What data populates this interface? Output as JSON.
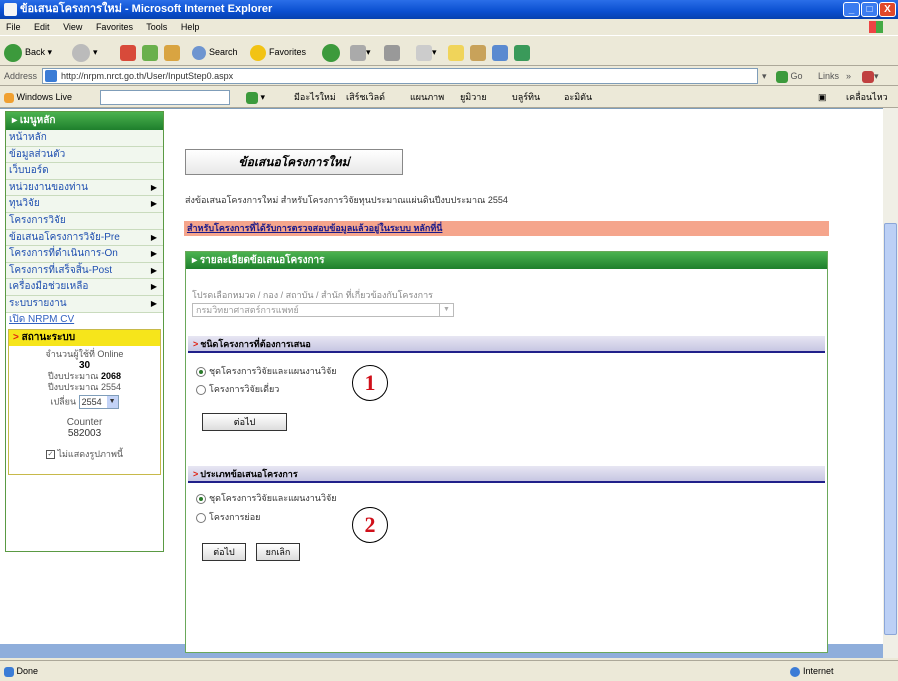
{
  "window": {
    "title": "ข้อเสนอโครงการใหม่ - Microsoft Internet Explorer",
    "min": "_",
    "max": "□",
    "close": "X"
  },
  "menu": [
    "File",
    "Edit",
    "View",
    "Favorites",
    "Tools",
    "Help"
  ],
  "toolbar": {
    "back": "Back",
    "search": "Search",
    "favorites": "Favorites"
  },
  "address": {
    "label": "Address",
    "url": "http://nrpm.nrct.go.th/User/InputStep0.aspx",
    "go": "Go",
    "links": "Links"
  },
  "links_bar": {
    "windows_live": "Windows Live",
    "items": [
      "มีอะไรใหม่",
      "เสิร์ชเวิลด์",
      "แผนภาพ",
      "ยูมิวาย",
      "บลูร์ทิน",
      "อะมิตัน"
    ],
    "right": "เคลื่อนไหว"
  },
  "sidebar": {
    "header": "เมนูหลัก",
    "items": [
      {
        "label": "หน้าหลัก",
        "submenu": false
      },
      {
        "label": "ข้อมูลส่วนตัว",
        "submenu": false
      },
      {
        "label": "เว็บบอร์ด",
        "submenu": false
      },
      {
        "label": "หน่วยงานของท่าน",
        "submenu": true
      },
      {
        "label": "ทุนวิจัย",
        "submenu": true
      },
      {
        "label": "โครงการวิจัย",
        "submenu": false
      },
      {
        "label": "ข้อเสนอโครงการวิจัย-Pre",
        "submenu": true
      },
      {
        "label": "โครงการที่ดำเนินการ-On",
        "submenu": true
      },
      {
        "label": "โครงการที่เสร็จสิ้น-Post",
        "submenu": true
      },
      {
        "label": "เครื่องมือช่วยเหลือ",
        "submenu": true
      },
      {
        "label": "ระบบรายงาน",
        "submenu": true
      }
    ],
    "extra_link": "เปิด NRPM CV",
    "status": {
      "header": "สถานะระบบ",
      "online_label": "จำนวนผู้ใช้ที่ Online",
      "online_count": "30",
      "fiscal_label": "ปีงบประมาณ",
      "fiscal_year_value": "2068",
      "budget_label": "ปีงบประมาณ 2554",
      "year_label": "เปลี่ยน",
      "year_value": "2554",
      "counter_label": "Counter",
      "counter_value": "582003",
      "remember_label": "ไม่แสดงรูปภาพนี้"
    }
  },
  "main": {
    "page_title": "ข้อเสนอโครงการใหม่",
    "description": "ส่งข้อเสนอโครงการใหม่ สำหรับโครงการวิจัยทุนประมาณแผ่นดินปีงบประมาณ 2554",
    "notice": "สำหรับโครงการที่ได้รับการตรวจสอบข้อมูลแล้วอยู่ในระบบ หลักที่นี่",
    "panel_title": "รายละเอียดข้อเสนอโครงการ",
    "instruction": "โปรดเลือกหมวด / กอง / สถาบัน / สำนัก ที่เกี่ยวข้องกับโครงการ",
    "dept_placeholder": "กรมวิทยาศาสตร์การแพทย์",
    "section1": {
      "title": "ชนิดโครงการที่ต้องการเสนอ",
      "options": [
        "ชุดโครงการวิจัยและแผนงานวิจัย",
        "โครงการวิจัยเดี่ยว"
      ],
      "button": "ต่อไป"
    },
    "section2": {
      "title": "ประเภทข้อเสนอโครงการ",
      "options": [
        "ชุดโครงการวิจัยและแผนงานวิจัย",
        "โครงการย่อย"
      ],
      "next_button": "ต่อไป",
      "cancel_button": "ยกเลิก"
    },
    "annotations": [
      "1",
      "2"
    ]
  },
  "status_bar": {
    "left": "Done",
    "zone": "Internet"
  }
}
